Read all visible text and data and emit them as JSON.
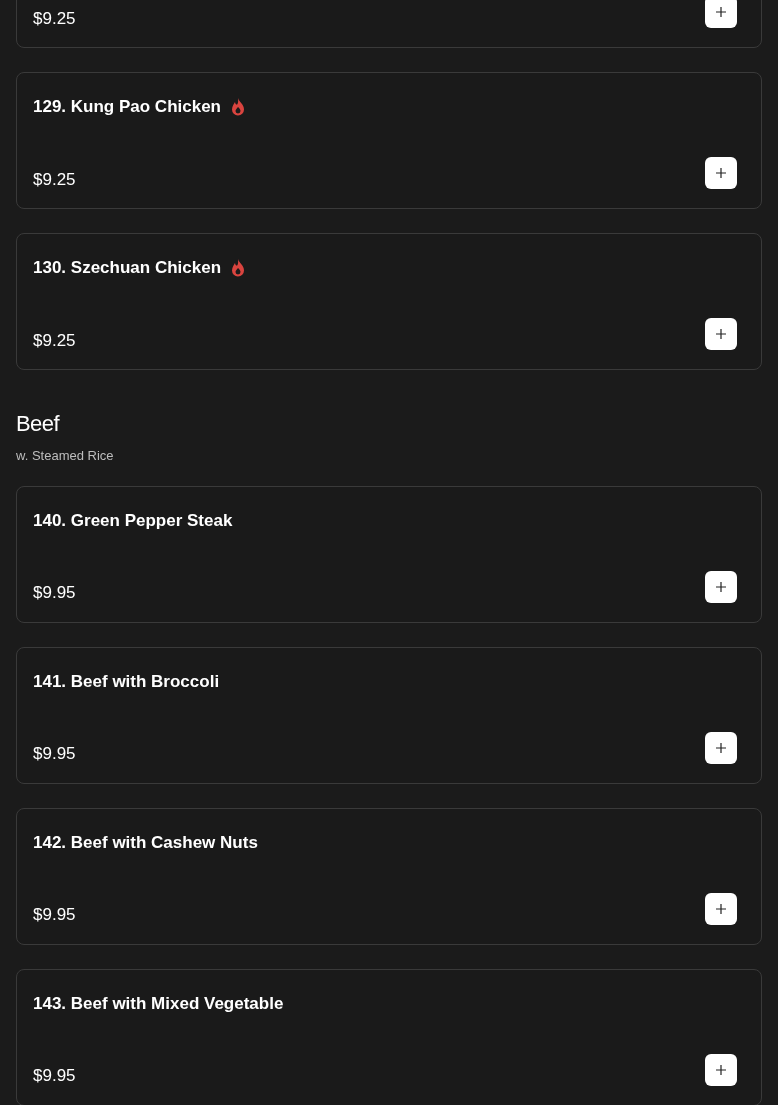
{
  "sections": [
    {
      "items": [
        {
          "price": "$9.25",
          "spicy": false
        },
        {
          "name": "129. Kung Pao Chicken",
          "price": "$9.25",
          "spicy": true
        },
        {
          "name": "130. Szechuan Chicken",
          "price": "$9.25",
          "spicy": true
        }
      ]
    },
    {
      "title": "Beef",
      "subtitle": "w. Steamed Rice",
      "items": [
        {
          "name": "140. Green Pepper Steak",
          "price": "$9.95",
          "spicy": false
        },
        {
          "name": "141. Beef with Broccoli",
          "price": "$9.95",
          "spicy": false
        },
        {
          "name": "142. Beef with Cashew Nuts",
          "price": "$9.95",
          "spicy": false
        },
        {
          "name": "143. Beef with Mixed Vegetable",
          "price": "$9.95",
          "spicy": false
        }
      ]
    }
  ]
}
